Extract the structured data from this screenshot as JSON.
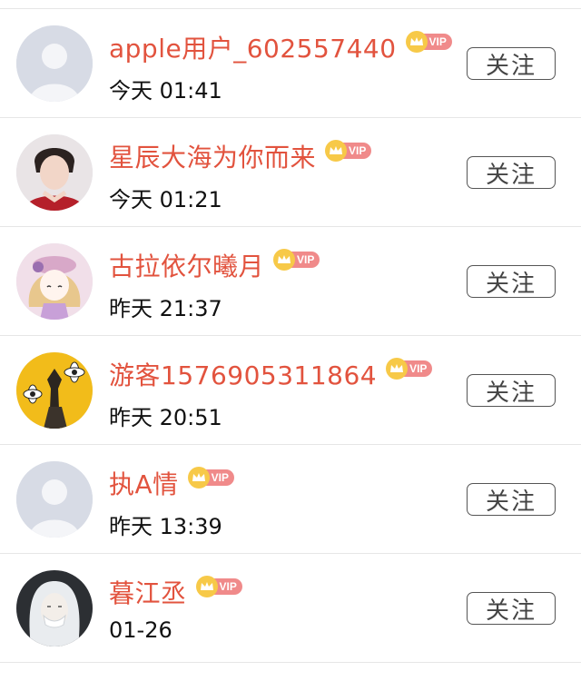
{
  "follow_label": "关注",
  "vip_label": "VIP",
  "users": [
    {
      "name": "apple用户_602557440",
      "time": "今天 01:41",
      "avatar": "default-avatar"
    },
    {
      "name": "星辰大海为你而来",
      "time": "今天 01:21",
      "avatar": "photo-avatar"
    },
    {
      "name": "古拉依尔曦月",
      "time": "昨天 21:37",
      "avatar": "illustration-avatar"
    },
    {
      "name": "游客1576905311864",
      "time": "昨天 20:51",
      "avatar": "artwork-avatar"
    },
    {
      "name": "执A情",
      "time": "昨天 13:39",
      "avatar": "default-avatar"
    },
    {
      "name": "暮江丞",
      "time": "01-26",
      "avatar": "photo-avatar"
    }
  ],
  "colors": {
    "name": "#e2533e",
    "vip_badge": "#f08a8a",
    "crown": "#f7c948",
    "divider": "#e6e6e6"
  }
}
